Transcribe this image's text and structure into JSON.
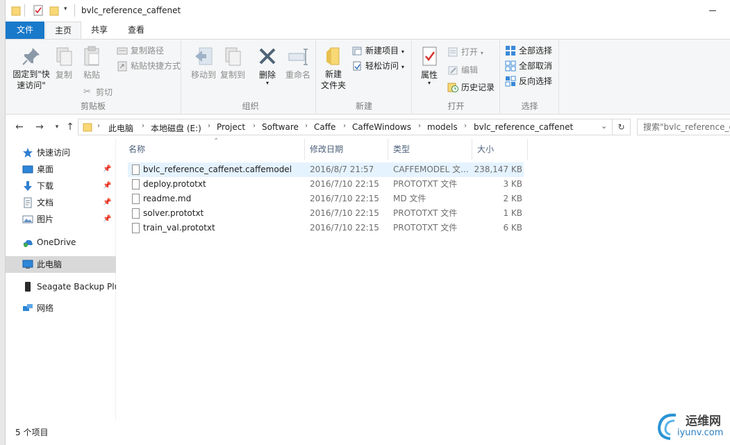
{
  "window": {
    "title": "bvlc_reference_caffenet"
  },
  "tabs": [
    "文件",
    "主页",
    "共享",
    "查看"
  ],
  "ribbon": {
    "clipboard": {
      "label": "剪贴板",
      "pin_quick": "固定到\"快\n速访问\"",
      "copy": "复制",
      "paste": "粘贴",
      "copy_path": "复制路径",
      "paste_shortcut": "粘贴快捷方式",
      "cut": "剪切"
    },
    "organize": {
      "label": "组织",
      "move_to": "移动到",
      "copy_to": "复制到",
      "delete": "删除",
      "rename": "重命名"
    },
    "new": {
      "label": "新建",
      "new_folder": "新建\n文件夹",
      "new_item": "新建项目",
      "easy_access": "轻松访问"
    },
    "open": {
      "label": "打开",
      "properties": "属性",
      "open": "打开",
      "edit": "编辑",
      "history": "历史记录"
    },
    "select": {
      "label": "选择",
      "select_all": "全部选择",
      "select_none": "全部取消",
      "invert": "反向选择"
    }
  },
  "address": {
    "crumbs": [
      "此电脑",
      "本地磁盘 (E:)",
      "Project",
      "Software",
      "Caffe",
      "CaffeWindows",
      "models",
      "bvlc_reference_caffenet"
    ],
    "search_placeholder": "搜索\"bvlc_reference_caffenet\""
  },
  "nav": {
    "quick_access": "快速访问",
    "desktop": "桌面",
    "downloads": "下载",
    "documents": "文档",
    "pictures": "图片",
    "onedrive": "OneDrive",
    "this_pc": "此电脑",
    "seagate": "Seagate Backup Plus",
    "network": "网络"
  },
  "columns": {
    "name": "名称",
    "date": "修改日期",
    "type": "类型",
    "size": "大小"
  },
  "files": [
    {
      "name": "bvlc_reference_caffenet.caffemodel",
      "date": "2016/8/7 21:57",
      "type": "CAFFEMODEL 文...",
      "size": "238,147 KB"
    },
    {
      "name": "deploy.prototxt",
      "date": "2016/7/10 22:15",
      "type": "PROTOTXT 文件",
      "size": "3 KB"
    },
    {
      "name": "readme.md",
      "date": "2016/7/10 22:15",
      "type": "MD 文件",
      "size": "2 KB"
    },
    {
      "name": "solver.prototxt",
      "date": "2016/7/10 22:15",
      "type": "PROTOTXT 文件",
      "size": "1 KB"
    },
    {
      "name": "train_val.prototxt",
      "date": "2016/7/10 22:15",
      "type": "PROTOTXT 文件",
      "size": "6 KB"
    }
  ],
  "status": {
    "count": "5 个项目"
  },
  "watermark": {
    "line1": "运维网",
    "line2": "iyunv.com"
  },
  "colors": {
    "file_tab": "#1979ca",
    "selected_row": "#e5f3ff",
    "nav_selected": "#d9d9d9",
    "folder": "#f8d775"
  }
}
